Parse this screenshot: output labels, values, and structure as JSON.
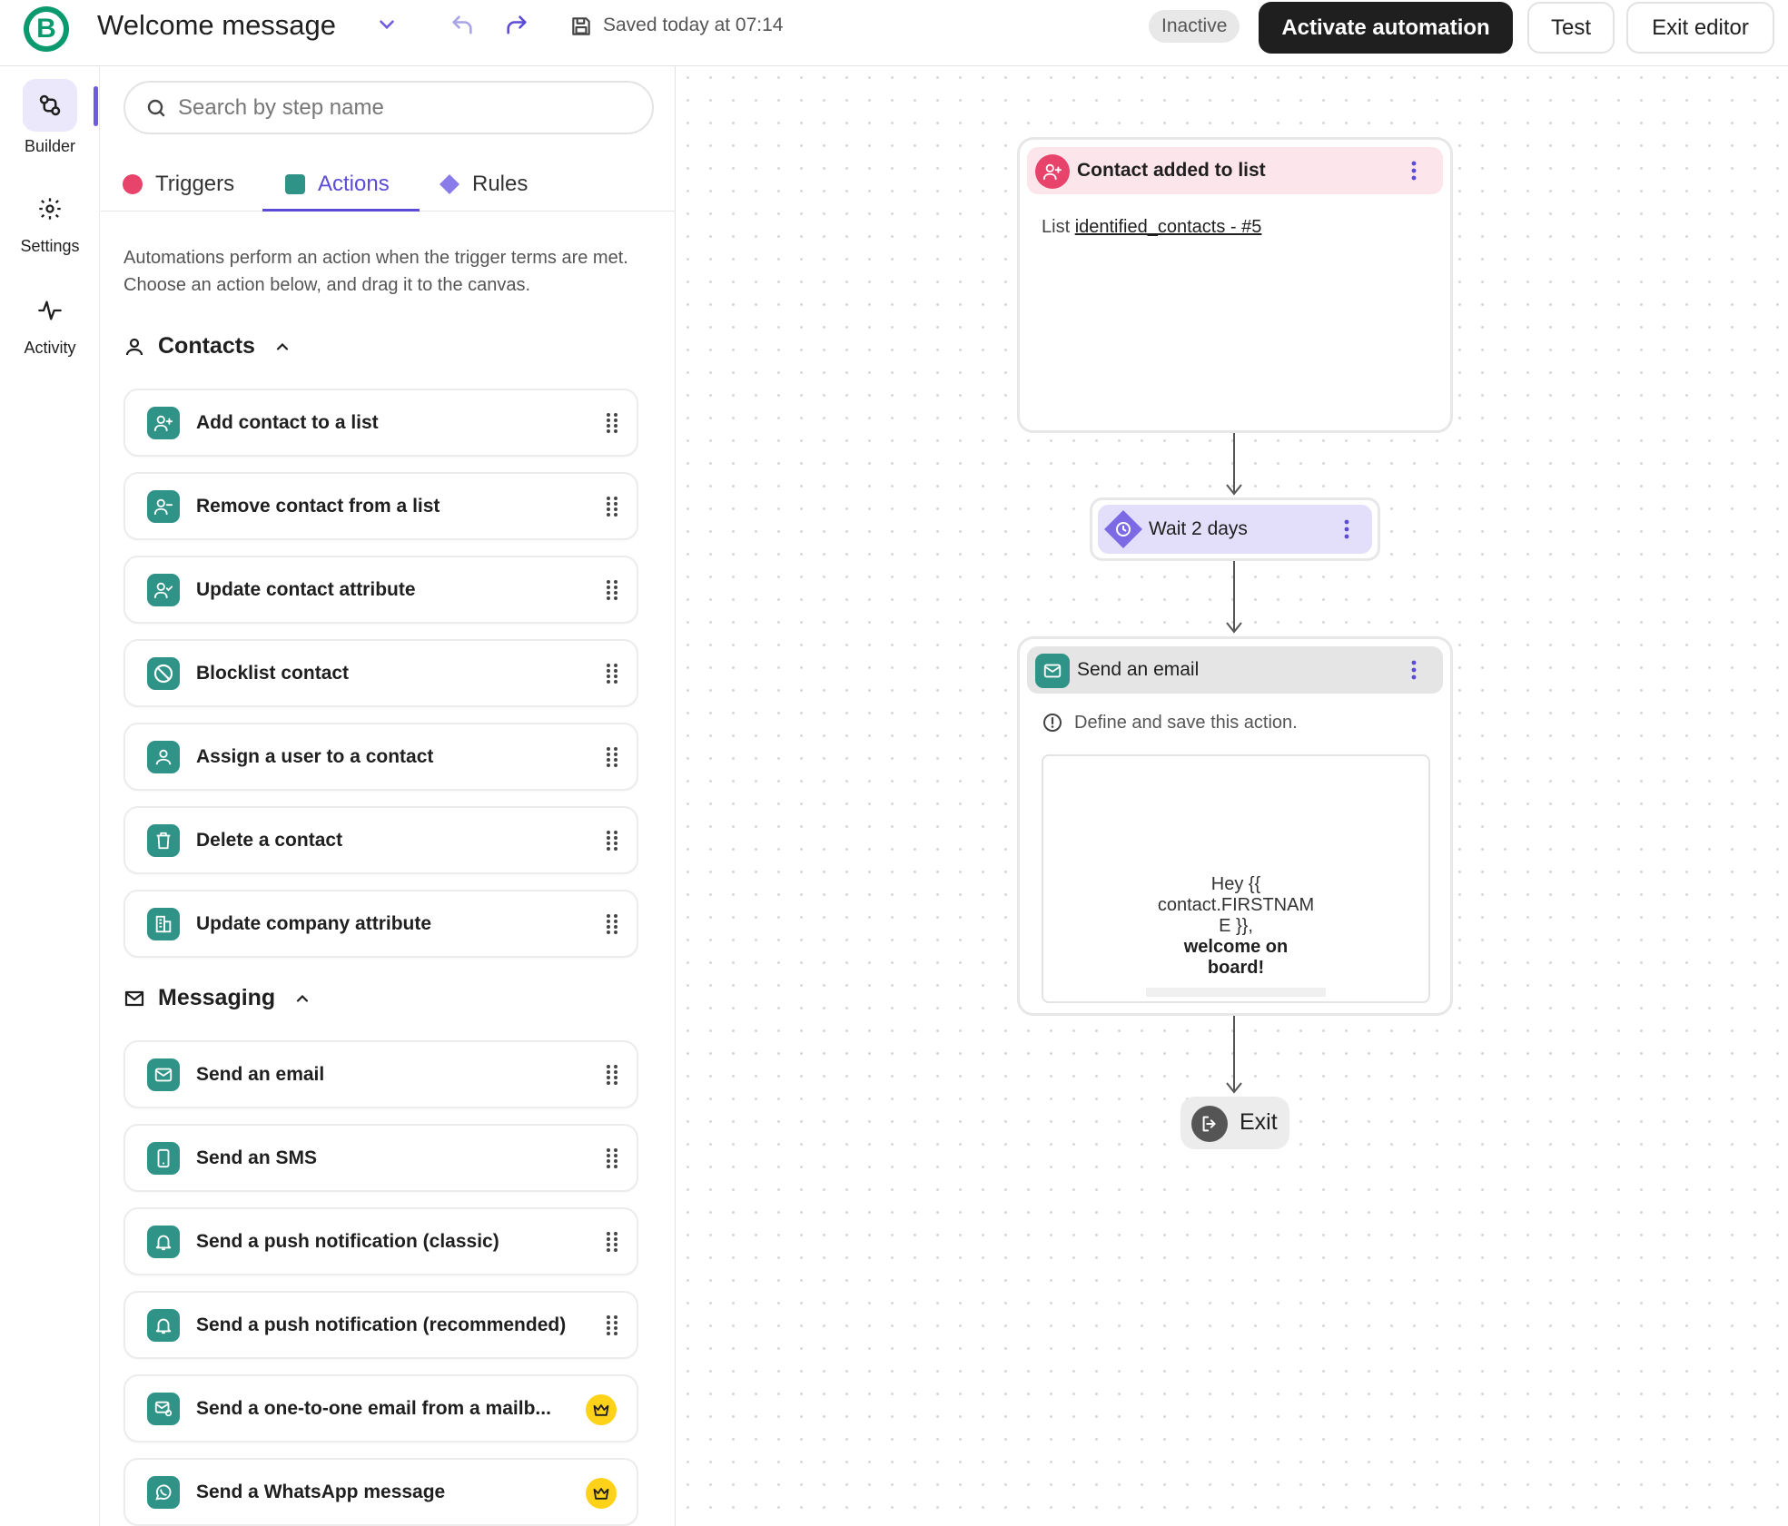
{
  "header": {
    "logo_letter": "B",
    "title": "Welcome message",
    "saved_text": "Saved today at 07:14",
    "status_badge": "Inactive",
    "activate_label": "Activate automation",
    "test_label": "Test",
    "exit_editor_label": "Exit editor"
  },
  "rail": {
    "items": [
      {
        "label": "Builder",
        "icon": "builder-icon",
        "active": true
      },
      {
        "label": "Settings",
        "icon": "gear-icon",
        "active": false
      },
      {
        "label": "Activity",
        "icon": "activity-icon",
        "active": false
      }
    ]
  },
  "panel": {
    "search_placeholder": "Search by step name",
    "tabs": [
      {
        "label": "Triggers",
        "color": "#e8436b"
      },
      {
        "label": "Actions",
        "color": "#2f9387",
        "active": true
      },
      {
        "label": "Rules",
        "color": "#8a7ce8"
      }
    ],
    "description": "Automations perform an action when the trigger terms are met. Choose an action below, and drag it to the canvas.",
    "sections": [
      {
        "title": "Contacts",
        "items": [
          {
            "label": "Add contact to a list",
            "icon": "user-plus-icon"
          },
          {
            "label": "Remove contact from a list",
            "icon": "user-minus-icon"
          },
          {
            "label": "Update contact attribute",
            "icon": "user-check-icon"
          },
          {
            "label": "Blocklist contact",
            "icon": "block-icon"
          },
          {
            "label": "Assign a user to a contact",
            "icon": "user-icon"
          },
          {
            "label": "Delete a contact",
            "icon": "trash-icon"
          },
          {
            "label": "Update company attribute",
            "icon": "building-icon"
          }
        ]
      },
      {
        "title": "Messaging",
        "items": [
          {
            "label": "Send an email",
            "icon": "mail-icon"
          },
          {
            "label": "Send an SMS",
            "icon": "phone-icon"
          },
          {
            "label": "Send a push notification (classic)",
            "icon": "bell-icon"
          },
          {
            "label": "Send a push notification (recommended)",
            "icon": "bell-icon"
          },
          {
            "label": "Send a one-to-one email from a mailb...",
            "icon": "mailbox-icon",
            "premium": true
          },
          {
            "label": "Send a WhatsApp message",
            "icon": "whatsapp-icon",
            "premium": true
          }
        ]
      }
    ]
  },
  "canvas": {
    "trigger_node": {
      "title": "Contact added to list",
      "list_prefix": "List",
      "list_value": "identified_contacts - #5"
    },
    "wait_node": {
      "title": "Wait 2 days"
    },
    "email_node": {
      "title": "Send an email",
      "warning": "Define and save this action.",
      "preview_line1": "Hey {{",
      "preview_line2": "contact.FIRSTNAM",
      "preview_line3": "E }},",
      "preview_line4": "welcome on",
      "preview_line5": "board!"
    },
    "exit_node": {
      "label": "Exit"
    }
  },
  "colors": {
    "accent": "#5b4bd6",
    "brand": "#0b996e",
    "action_teal": "#2f9387",
    "trigger_pink": "#e8436b",
    "rule_purple": "#8a7ce8",
    "premium_yellow": "#ffd21a"
  }
}
